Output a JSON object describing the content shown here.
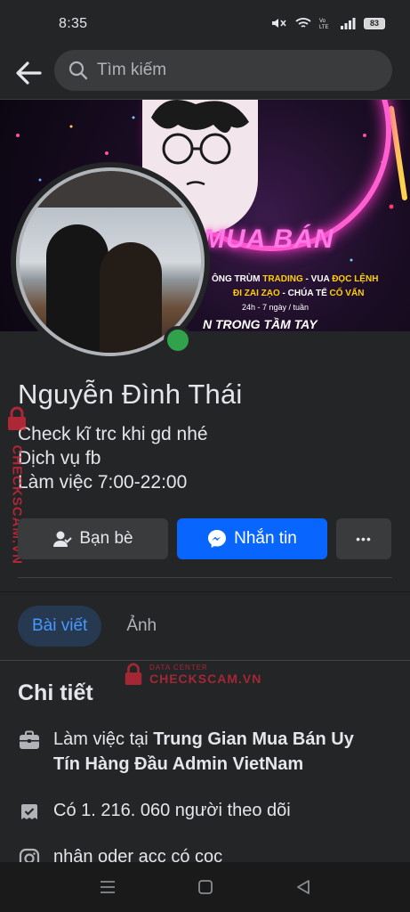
{
  "status_bar": {
    "time": "8:35",
    "battery": "83"
  },
  "top_bar": {
    "search_placeholder": "Tìm kiếm"
  },
  "cover": {
    "title": "MUA BÁN",
    "line1_a": "ÔNG TRÙM ",
    "line1_b": "TRADING",
    "line1_c": " - VUA ",
    "line1_d": "ĐỌC LỆNH",
    "line2_a": "ĐI ZAI ZẠO",
    "line2_b": " - CHÚA TỂ ",
    "line2_c": "CỐ VẤN",
    "line3": "24h - 7 ngày / tuần",
    "line4": "N TRONG TẦM TAY"
  },
  "profile": {
    "name": "Nguyễn Đình Thái",
    "bio": [
      "Check kĩ trc khi gd nhé",
      "Dịch vụ fb",
      "Làm việc 7:00-22:00"
    ]
  },
  "actions": {
    "friends_label": "Bạn bè",
    "message_label": "Nhắn tin",
    "more_label": "•••"
  },
  "tabs": {
    "posts": "Bài viết",
    "photos": "Ảnh"
  },
  "details": {
    "title": "Chi tiết",
    "work_prefix": "Làm việc tại ",
    "work_place": "Trung Gian Mua Bán Uy Tín Hàng Đầu Admin VietNam",
    "followers": "Có 1. 216. 060 người theo dõi",
    "instagram": "nhận oder acc có cọc"
  },
  "watermark": {
    "brand": "CHECKSCAM.VN",
    "sub": "DATA CENTER"
  },
  "colors": {
    "primary": "#0866ff",
    "online": "#31a24c",
    "tab_active_bg": "#263951",
    "tab_active_text": "#4599ff"
  }
}
